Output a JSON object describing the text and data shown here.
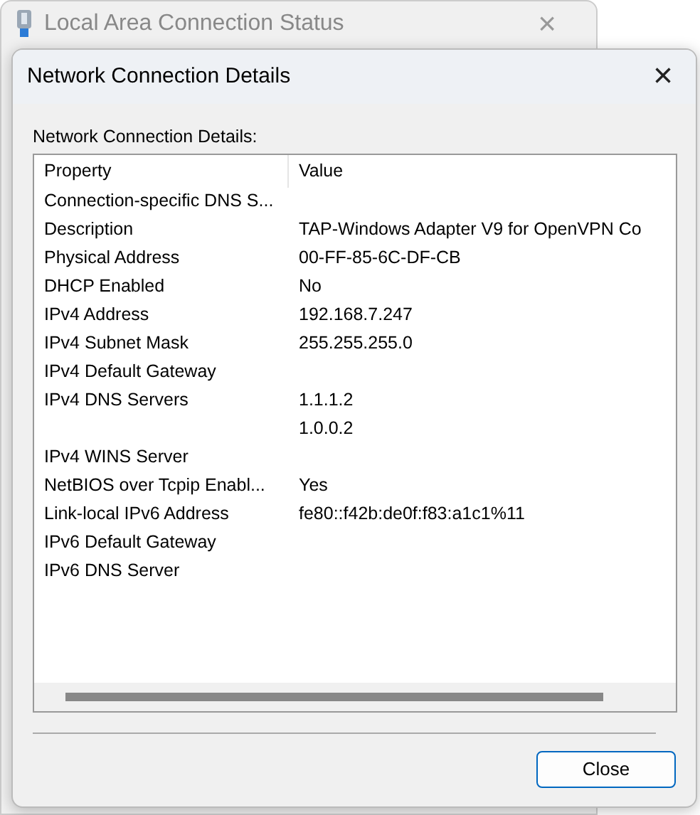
{
  "background_window": {
    "title": "Local Area Connection Status",
    "close": "×"
  },
  "dialog": {
    "title": "Network Connection Details",
    "close": "×",
    "label": "Network Connection Details:",
    "columns": [
      "Property",
      "Value"
    ],
    "rows": [
      {
        "property": "Connection-specific DNS S..."
      },
      {
        "property": "Description",
        "value": "TAP-Windows Adapter V9 for OpenVPN Co"
      },
      {
        "property": "Physical Address",
        "value": "00-FF-85-6C-DF-CB"
      },
      {
        "property": "DHCP Enabled",
        "value": "No"
      },
      {
        "property": "IPv4 Address",
        "value": "192.168.7.247"
      },
      {
        "property": "IPv4 Subnet Mask",
        "value": "255.255.255.0"
      },
      {
        "property": "IPv4 Default Gateway"
      },
      {
        "property": "IPv4 DNS Servers",
        "value": "1.1.1.2"
      },
      {
        "value": "1.0.0.2"
      },
      {
        "property": "IPv4 WINS Server"
      },
      {
        "property": "NetBIOS over Tcpip Enabl...",
        "value": "Yes"
      },
      {
        "property": "Link-local IPv6 Address",
        "value": "fe80::f42b:de0f:f83:a1c1%11"
      },
      {
        "property": "IPv6 Default Gateway"
      },
      {
        "property": "IPv6 DNS Server"
      }
    ],
    "buttons": [
      "Close"
    ]
  }
}
